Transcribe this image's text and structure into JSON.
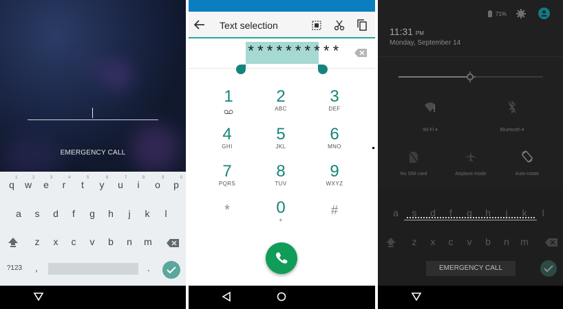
{
  "lockscreen": {
    "emergency_call": "EMERGENCY CALL",
    "keyboard": {
      "row1": [
        "q",
        "w",
        "e",
        "r",
        "t",
        "y",
        "u",
        "i",
        "o",
        "p"
      ],
      "row2": [
        "a",
        "s",
        "d",
        "f",
        "g",
        "h",
        "j",
        "k",
        "l"
      ],
      "row3": [
        "z",
        "x",
        "c",
        "v",
        "b",
        "n",
        "m"
      ],
      "symbols_key": "?123",
      "comma": ",",
      "period": "."
    }
  },
  "dialer": {
    "title": "Text selection",
    "digits": "**********",
    "keys": [
      {
        "num": "1",
        "sub": ""
      },
      {
        "num": "2",
        "sub": "ABC"
      },
      {
        "num": "3",
        "sub": "DEF"
      },
      {
        "num": "4",
        "sub": "GHI"
      },
      {
        "num": "5",
        "sub": "JKL"
      },
      {
        "num": "6",
        "sub": "MNO"
      },
      {
        "num": "7",
        "sub": "PQRS"
      },
      {
        "num": "8",
        "sub": "TUV"
      },
      {
        "num": "9",
        "sub": "WXYZ"
      },
      {
        "num": "*",
        "sub": ""
      },
      {
        "num": "0",
        "sub": "+"
      },
      {
        "num": "#",
        "sub": ""
      }
    ],
    "accent": "#14857a",
    "call_color": "#0f9d58",
    "statusbar_color": "#0a7fbf"
  },
  "shade": {
    "battery": "71%",
    "time": "11:31",
    "ampm": "PM",
    "date": "Monday, September 14",
    "tiles": [
      {
        "label": "Wi-Fi",
        "icon": "wifi-icon"
      },
      {
        "label": "Bluetooth",
        "icon": "bluetooth-icon"
      },
      {
        "label": "No SIM card",
        "icon": "no-sim-icon"
      },
      {
        "label": "Airplane mode",
        "icon": "airplane-icon"
      },
      {
        "label": "Auto-rotate",
        "icon": "rotate-icon"
      }
    ],
    "keyboard": {
      "row2": [
        "a",
        "s",
        "d",
        "f",
        "g",
        "h",
        "j",
        "k",
        "l"
      ],
      "row3": [
        "z",
        "x",
        "c",
        "v",
        "b",
        "n",
        "m"
      ]
    },
    "emergency_call": "EMERGENCY CALL"
  }
}
